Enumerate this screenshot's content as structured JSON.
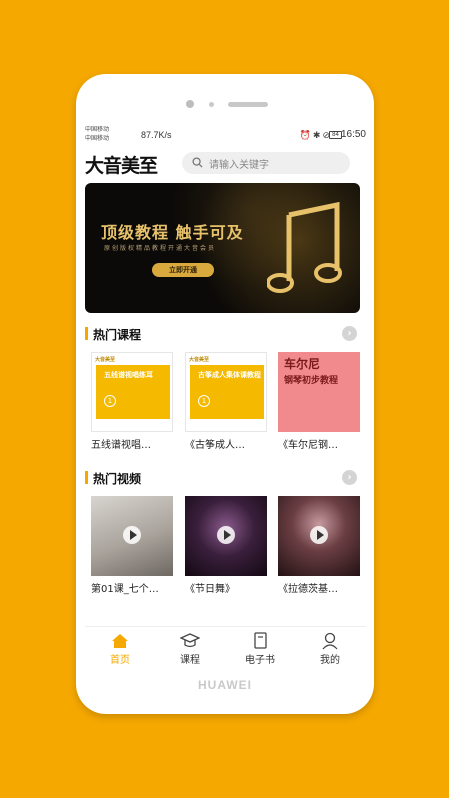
{
  "status": {
    "carrier1": "中国移动",
    "carrier2": "中国移动",
    "network_speed": "87.7K/s",
    "battery": "84",
    "time": "16:50"
  },
  "header": {
    "logo_text": "大音美至",
    "search_placeholder": "请输入关键字"
  },
  "banner": {
    "title": "顶级教程 触手可及",
    "subtitle": "原创版权精品教程开通大音会员",
    "button": "立即开通"
  },
  "hot_courses": {
    "title": "热门课程",
    "items": [
      {
        "caption": "五线谱视唱…",
        "cover_title": "五线谱视唱练耳",
        "cover_tag": "大音美至",
        "cover_num": "1"
      },
      {
        "caption": "《古筝成人…",
        "cover_title": "古筝成人集体课教程",
        "cover_tag": "大音美至",
        "cover_num": "1"
      },
      {
        "caption": "《车尔尼钢…",
        "cover_title": "车尔尼",
        "cover_sub": "钢琴初步教程"
      }
    ]
  },
  "hot_videos": {
    "title": "热门视频",
    "items": [
      {
        "caption": "第01课_七个…"
      },
      {
        "caption": "《节日舞》"
      },
      {
        "caption": "《拉德茨基…"
      }
    ]
  },
  "tabbar": [
    {
      "label": "首页",
      "icon": "home-icon",
      "active": true
    },
    {
      "label": "课程",
      "icon": "graduation-cap-icon",
      "active": false
    },
    {
      "label": "电子书",
      "icon": "book-icon",
      "active": false
    },
    {
      "label": "我的",
      "icon": "user-icon",
      "active": false
    }
  ],
  "device_brand": "HUAWEI",
  "colors": {
    "accent": "#F5A800",
    "background": "#F5A800"
  }
}
